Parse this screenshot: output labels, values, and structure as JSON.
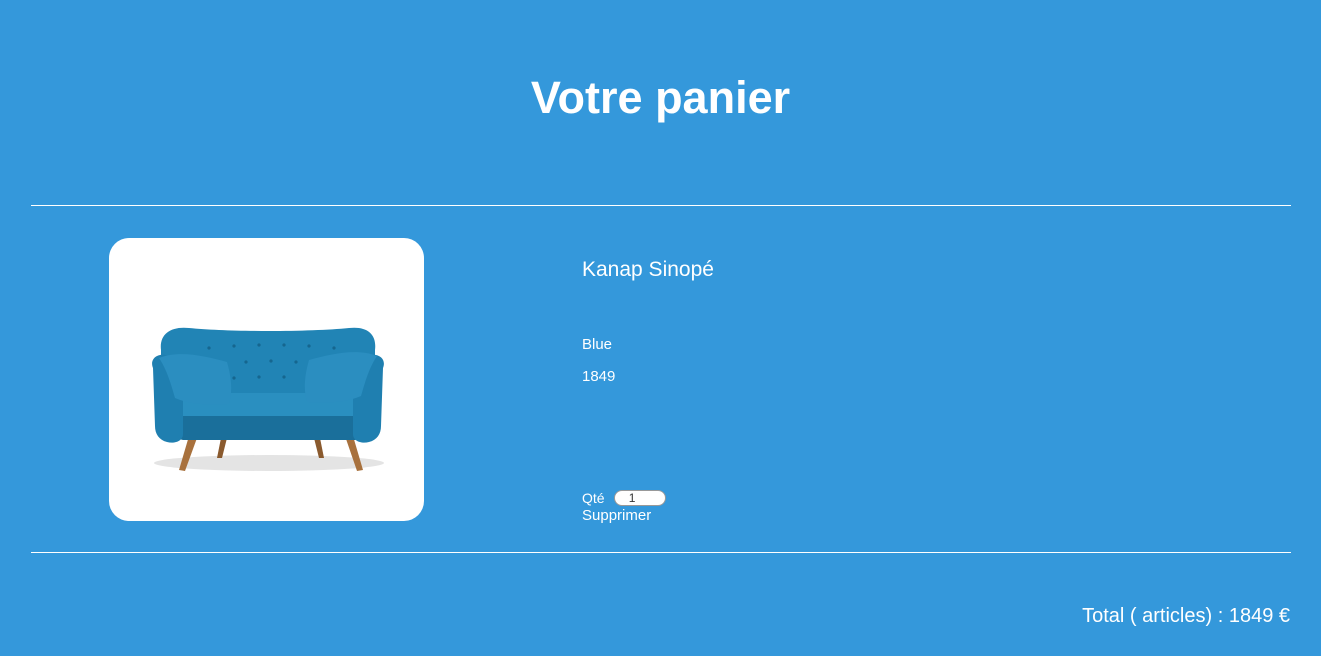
{
  "header": {
    "title": "Votre panier"
  },
  "cart": {
    "items": [
      {
        "name": "Kanap Sinopé",
        "color": "Blue",
        "price": "1849",
        "quantity_label": "Qté",
        "quantity_value": "1",
        "delete_label": "Supprimer",
        "image_icon": "sofa-image"
      }
    ]
  },
  "total": {
    "label": "Total ( articles) : 1849 €"
  },
  "colors": {
    "background": "#3498db",
    "text": "#ffffff",
    "sofa": "#1f7fb0"
  }
}
